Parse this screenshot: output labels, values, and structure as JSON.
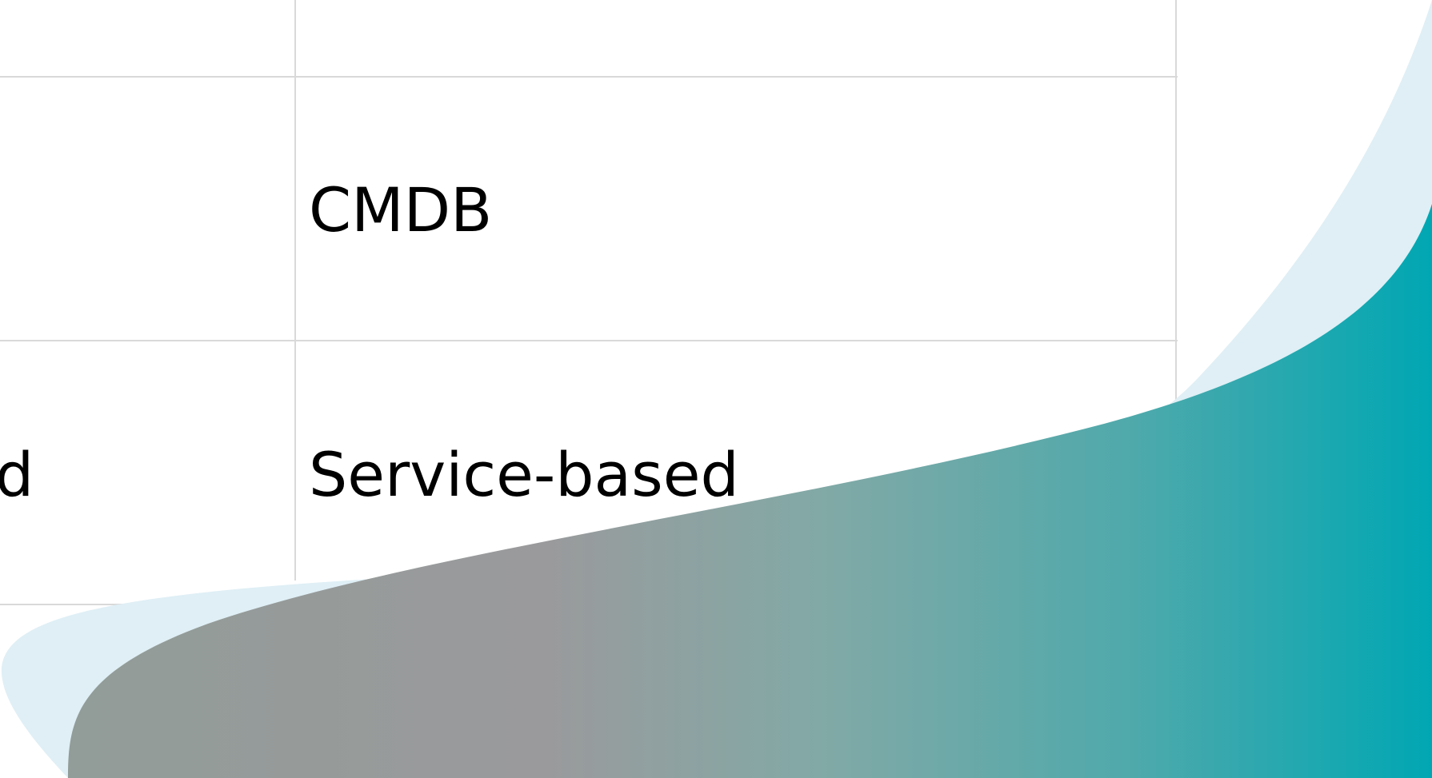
{
  "table": {
    "rows": [
      {
        "right": ""
      },
      {
        "right": "CMDB"
      },
      {
        "left_fragment": "d",
        "right": "Service-based"
      }
    ]
  },
  "colors": {
    "grid_line": "#d9d9d9",
    "light_wave": "#dfeff5",
    "teal": "#00a7b3",
    "gray": "#9c9c9c"
  }
}
